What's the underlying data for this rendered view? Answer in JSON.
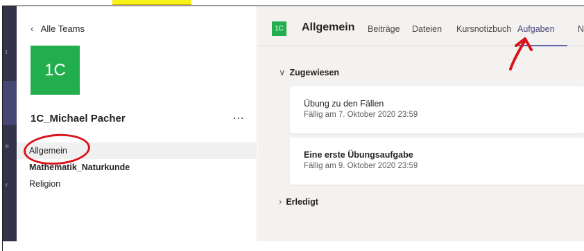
{
  "left_panel": {
    "back_label": "Alle Teams",
    "team_avatar": "1C",
    "team_name": "1C_Michael Pacher",
    "more_label": "...",
    "channels": [
      {
        "label": "Allgemein"
      },
      {
        "label": "Mathematik_Naturkunde"
      },
      {
        "label": "Religion"
      }
    ]
  },
  "header": {
    "avatar": "1C",
    "title": "Allgemein",
    "tabs": [
      {
        "label": "Beiträge"
      },
      {
        "label": "Dateien"
      },
      {
        "label": "Kursnotizbuch"
      },
      {
        "label": "Aufgaben"
      },
      {
        "label": "N"
      }
    ]
  },
  "assignments": {
    "assigned_label": "Zugewiesen",
    "done_label": "Erledigt",
    "items": [
      {
        "title": "Übung zu den Fällen",
        "due": "Fällig am 7. Oktober 2020 23:59"
      },
      {
        "title": "Eine erste Übungsaufgabe",
        "due": "Fällig am 9. Oktober 2020 23:59"
      }
    ]
  },
  "colors": {
    "accent": "#6264a7",
    "team_green": "#22ae4d",
    "annotation_red": "#d8141b",
    "highlight_yellow": "#f7f21a"
  }
}
